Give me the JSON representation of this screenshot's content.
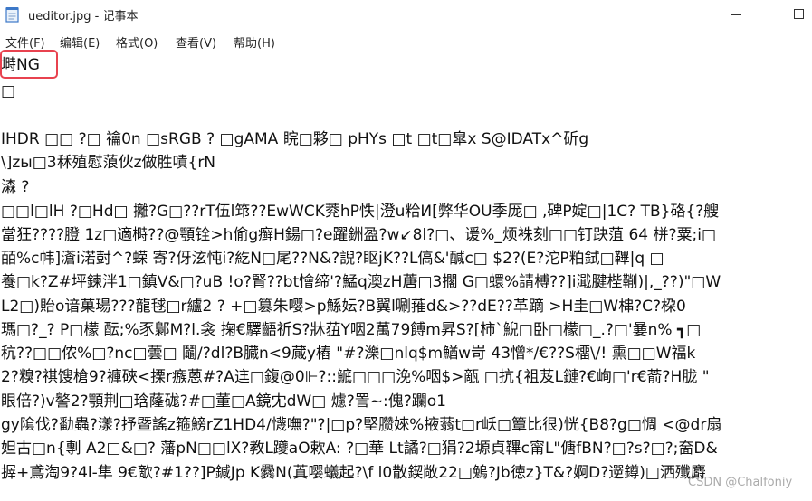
{
  "window": {
    "title": "ueditor.jpg - 记事本"
  },
  "menu": [
    "文件(F)",
    "编辑(E)",
    "格式(O)",
    "查看(V)",
    "帮助(H)"
  ],
  "lines": [
    "塒NG",
    "□",
    "",
    "IHDR  □□   ?□   禴0n   □sRGB    ?   □gAMA  睆□夥□              pHYs  □t  □t□皐x  S@IDATx^斫g",
    "\\]zы□3秝殖慰蒗伙z做胜嘖{rN",
    "潹    ?",
    "□□l□lH  ?□Hd□  攡?G□??rT伍l筇??EwWCK萒hP怢|澄u粭И[弊华OU季厐□    ,碑P婝□|1C?    TB}硌{?艘",
    "當狂????膯  1z□適榯??@顎铨>h偷g癣H鍚□?e躍銂盈?w↙8l?□、谖%_烦袾刻□□钉趹菹    64 栟?粟;i□",
    "皕%c帏]濸i渃尌^?蝾    寄?伢泫忳i?紇N□尾??N&?誽?眍jK??L傐&'醎c□         $2?(E?沱P粕鉽□鞸|q    □",
    "養□k?Z#坪鍊泮1□鎮V&□?uB    !o?腎??bt懀缔'?鯭q澳zH蓎□3擱 G□蠉%請榑??]i濈腱梐鞩)|,_??)\"□W",
    "L2□)貽o谙菓瑒???龍毬□r纑2    ?    +□篡朱嘤>p鯀妘?B翼l唰蓷d&>??dE??革蹢    >H圭□W梙?C?桗0",
    "瑪□?_?    P□檬    酝;%豕鄡M?l.衾    掬€驛齬祈S?牀莥Y咽2萬79餺m昇S?[柿`鯢□卧□檬□_.?□'嘦n% ┓□",
    "秔??□□侬%□?nc□蕓□    鬮/?dl?B臓n<9蕆y樁    \"#?濼□nlq$m鰌w岢    43憎*/€??S橊\\/!    熏□□W福k",
    "    2?糗?祺馊槍9?褲硤<搮r瘯蒽#?A迬□鍑@0⊩?::鯳□□□浼%咽$>甋 □抗{袓芨L鏈?€峋□'r€萮?H胧 \"",
    "眼倍?)v譥2?顎荆□琀蕯硥?#□董□A鏡冘dW□    爈?詈~:傀?躝o1",
    "gy隂伐?勫蟲?漾?抒暨謠z箍鰟rZ1HD4/懱嘸?\"?|□p?堅臜婡%掖蓊t□r岆□簟比很)恍{B8?g□惆    <@dr扇",
    "妲古□n{剸    A2□&□?    藩pN□□lX?教L躨aO欶A: ?□華    Lt譎?□狷?2塬貞鞸c甯L\"傏fBN?□?s?□?;奤D&",
    "搱+鳶淘9?4l-隼 9€歒?#1??]P鍼Jp K爨N(蒖嘤蟻起?\\f    l0散鍥敞22□鵵?Jb徳z}T&?婀D?遻鐏)□洒殲麝"
  ],
  "watermark": "CSDN @Chalfoniy"
}
